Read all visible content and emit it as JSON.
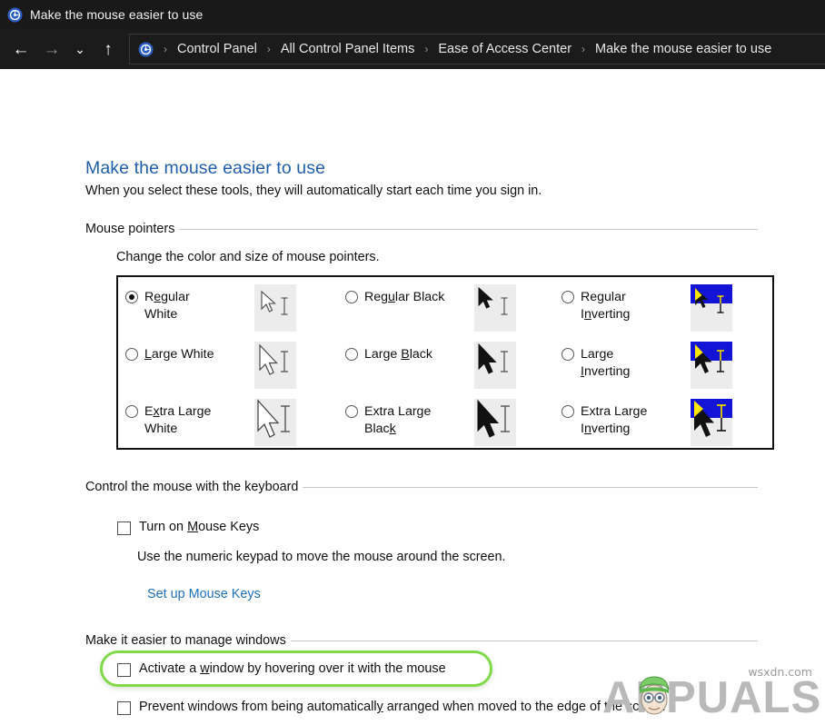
{
  "window": {
    "title": "Make the mouse easier to use",
    "icon": "control-panel-icon"
  },
  "nav": {
    "back": "←",
    "forward": "→",
    "recent": "⌄",
    "up": "↑",
    "separator": "›",
    "breadcrumbs": [
      "Control Panel",
      "All Control Panel Items",
      "Ease of Access Center",
      "Make the mouse easier to use"
    ]
  },
  "page": {
    "heading": "Make the mouse easier to use",
    "subtitle": "When you select these tools, they will automatically start each time you sign in."
  },
  "sections": {
    "mouse_pointers": {
      "label": "Mouse pointers",
      "note": "Change the color and size of mouse pointers.",
      "options": [
        {
          "label_pre": "R",
          "label_key": "e",
          "label_post": "gular White",
          "line1": "Regular",
          "line2": "White",
          "checked": true,
          "style": "white"
        },
        {
          "label_pre": "",
          "label_key": "L",
          "label_post": "arge White",
          "line1": "Large White",
          "line2": "",
          "checked": false,
          "style": "white"
        },
        {
          "label_pre": "E",
          "label_key": "x",
          "label_post": "tra Large White",
          "line1": "Extra Large",
          "line2": "White",
          "checked": false,
          "style": "white"
        },
        {
          "label_pre": "Reg",
          "label_key": "u",
          "label_post": "lar Black",
          "line1": "Regular Black",
          "line2": "",
          "checked": false,
          "style": "black"
        },
        {
          "label_pre": "Large ",
          "label_key": "B",
          "label_post": "lack",
          "line1": "Large Black",
          "line2": "",
          "checked": false,
          "style": "black"
        },
        {
          "label_pre": "Extra Large Blac",
          "label_key": "k",
          "label_post": "",
          "line1": "Extra Large",
          "line2": "Black",
          "checked": false,
          "style": "black"
        },
        {
          "label_pre": "Regular I",
          "label_key": "n",
          "label_post": "verting",
          "line1": "Regular",
          "line2": "Inverting",
          "checked": false,
          "style": "inverting"
        },
        {
          "label_pre": "Large ",
          "label_key": "I",
          "label_post": "nverting",
          "line1": "Large",
          "line2": "Inverting",
          "checked": false,
          "style": "inverting"
        },
        {
          "label_pre": "Extra Large I",
          "label_key": "n",
          "label_post": "verting",
          "line1": "Extra Large",
          "line2": "Inverting",
          "checked": false,
          "style": "inverting"
        }
      ]
    },
    "keyboard_control": {
      "label": "Control the mouse with the keyboard",
      "checkbox": {
        "pre": "Turn on ",
        "key": "M",
        "post": "ouse Keys",
        "checked": false
      },
      "note": "Use the numeric keypad to move the mouse around the screen.",
      "link": "Set up Mouse Keys"
    },
    "manage_windows": {
      "label": "Make it easier to manage windows",
      "checkboxes": [
        {
          "pre": "Activate a ",
          "key": "w",
          "post": "indow by hovering over it with the mouse",
          "checked": false,
          "highlighted": true
        },
        {
          "pre": "Prevent windows from being automaticall",
          "key": "y",
          "post": " arranged when moved to the edge of the screen",
          "checked": false,
          "highlighted": false
        }
      ]
    }
  },
  "watermark": {
    "text": "APPUALS"
  },
  "footer": {
    "url": "wsxdn.com"
  },
  "colors": {
    "titlebar_bg": "#191919",
    "heading": "#1f5faa",
    "link": "#1f6fb8",
    "highlight_green": "#80d948",
    "inverting_blue": "#1414d6",
    "inverting_yellow": "#ffe800"
  }
}
